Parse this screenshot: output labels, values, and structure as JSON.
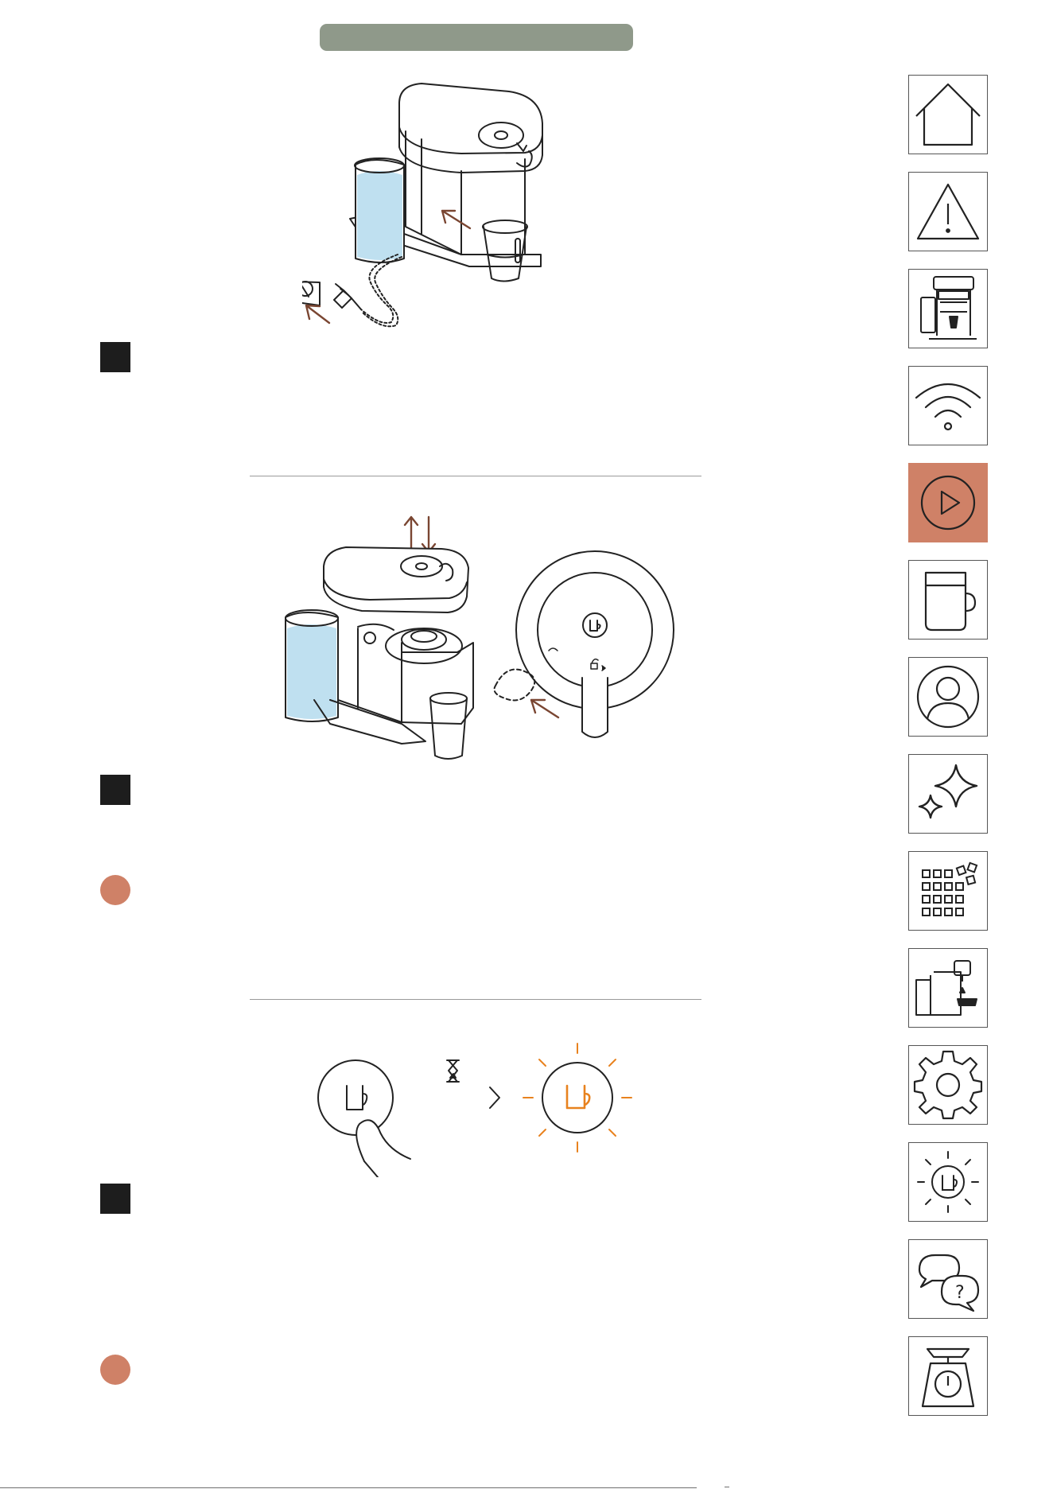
{
  "colors": {
    "title_bar": "#8f998a",
    "step_marker": "#1d1d1d",
    "note_marker": "#cf8167",
    "active_nav": "#cf8167",
    "glow": "#e8821e",
    "arrow": "#7a4632",
    "water": "#bfe0f0"
  },
  "sidebar": {
    "items": [
      {
        "icon": "home-icon",
        "active": false
      },
      {
        "icon": "warning-icon",
        "active": false
      },
      {
        "icon": "machine-icon",
        "active": false
      },
      {
        "icon": "wifi-icon",
        "active": false
      },
      {
        "icon": "play-icon",
        "active": true
      },
      {
        "icon": "mug-icon",
        "active": false
      },
      {
        "icon": "user-icon",
        "active": false
      },
      {
        "icon": "sparkle-icon",
        "active": false
      },
      {
        "icon": "capsule-grid-icon",
        "active": false
      },
      {
        "icon": "descaling-icon",
        "active": false
      },
      {
        "icon": "gear-icon",
        "active": false
      },
      {
        "icon": "brew-button-icon",
        "active": false
      },
      {
        "icon": "faq-icon",
        "active": false
      },
      {
        "icon": "scale-icon",
        "active": false
      }
    ]
  }
}
